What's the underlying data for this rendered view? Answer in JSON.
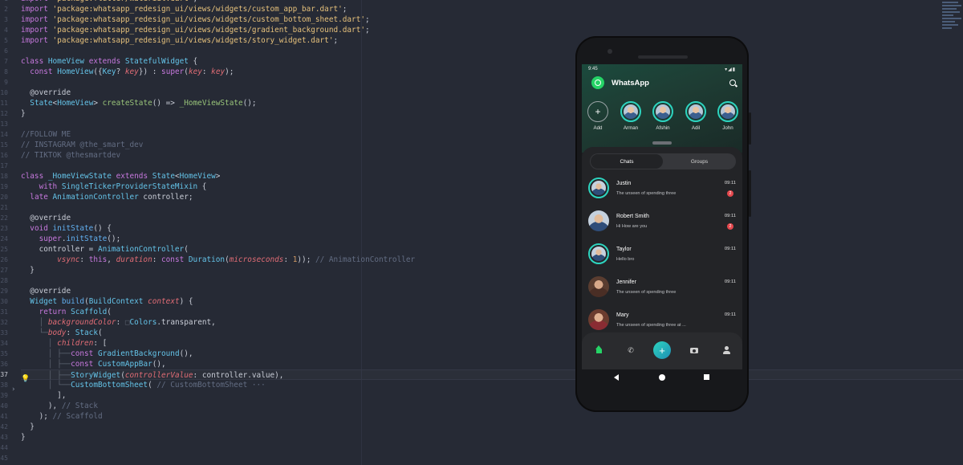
{
  "editor": {
    "line_numbers": [
      "1",
      "2",
      "3",
      "4",
      "5",
      "6",
      "7",
      "8",
      "9",
      "10",
      "11",
      "12",
      "13",
      "14",
      "15",
      "16",
      "17",
      "18",
      "19",
      "20",
      "21",
      "22",
      "23",
      "24",
      "25",
      "26",
      "27",
      "28",
      "29",
      "30",
      "31",
      "32",
      "33",
      "34",
      "35",
      "36",
      "37",
      "38",
      "39",
      "40",
      "41",
      "42",
      "43",
      "44",
      "45"
    ],
    "active_line": 37
  },
  "app": {
    "status_time": "9:45",
    "status_icons": "▾◢▮",
    "title": "WhatsApp",
    "stories": [
      {
        "name": "Add"
      },
      {
        "name": "Arman"
      },
      {
        "name": "Afshin"
      },
      {
        "name": "Adil"
      },
      {
        "name": "John"
      }
    ],
    "tabs": {
      "chats": "Chats",
      "groups": "Groups"
    },
    "chats": [
      {
        "name": "Justin",
        "message": "The unseen of spending three",
        "time": "09:11",
        "badge": "2"
      },
      {
        "name": "Robert Smith",
        "message": "Hi How are you",
        "time": "09:11",
        "badge": "2"
      },
      {
        "name": "Taylor",
        "message": "Hello bro",
        "time": "09:11"
      },
      {
        "name": "Jennifer",
        "message": "The unseen of spending three",
        "time": "09:11"
      },
      {
        "name": "Mary",
        "message": "The unseen of spending three at ...",
        "time": "09:11"
      }
    ],
    "nav": {
      "add": "+",
      "call": "✆"
    }
  },
  "colors": {
    "accent": "#25d366",
    "teal": "#2dd4bf",
    "badge": "#e5484d",
    "editor_bg": "#262a35"
  },
  "icons": [
    "whatsapp-logo-icon",
    "search-icon",
    "add-story-icon",
    "home-icon",
    "call-icon",
    "add-icon",
    "camera-icon",
    "profile-icon",
    "back-icon",
    "home-circle-icon",
    "recents-icon",
    "lightbulb-icon"
  ]
}
